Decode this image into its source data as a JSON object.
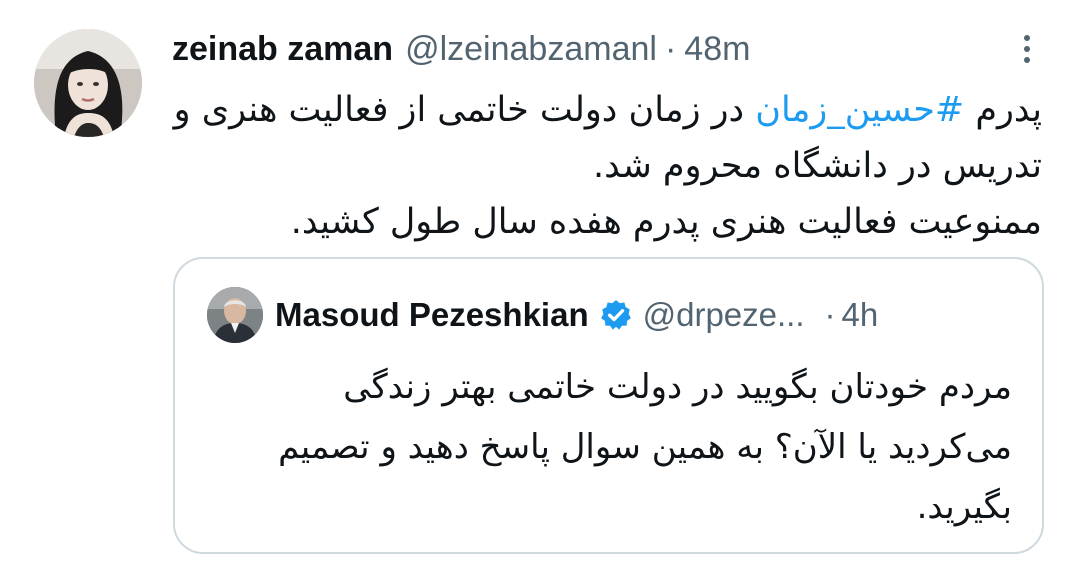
{
  "tweet": {
    "author_name": "zeinab zaman",
    "author_handle": "@lzeinabzamanl",
    "separator": "·",
    "time": "48m",
    "text": {
      "line1_prefix": "پدرم ",
      "hashtag": "#حسین_زمان",
      "line1_suffix": " در زمان دولت خاتمی از فعالیت هنری و",
      "line2": "تدریس در دانشگاه محروم شد.",
      "line3": "ممنوعیت فعالیت هنری پدرم هفده سال طول کشید."
    },
    "icons": {
      "more": "more-vertical-icon"
    }
  },
  "quoted_tweet": {
    "author_name": "Masoud Pezeshkian",
    "author_handle": "@drpeze...",
    "separator": "·",
    "time": "4h",
    "verified_color": "#1d9bf0",
    "text": {
      "line1": "مردم خودتان بگویید در دولت خاتمی بهتر زندگی",
      "line2": "می‌کردید یا الآن؟ به همین سوال پاسخ دهید و تصمیم",
      "line3": "بگیرید."
    },
    "icons": {
      "verified": "verified-badge-icon"
    }
  },
  "colors": {
    "text": "#0f1419",
    "secondary": "#536471",
    "link": "#1d9bf0",
    "border": "#cfd9de",
    "background": "#ffffff"
  }
}
